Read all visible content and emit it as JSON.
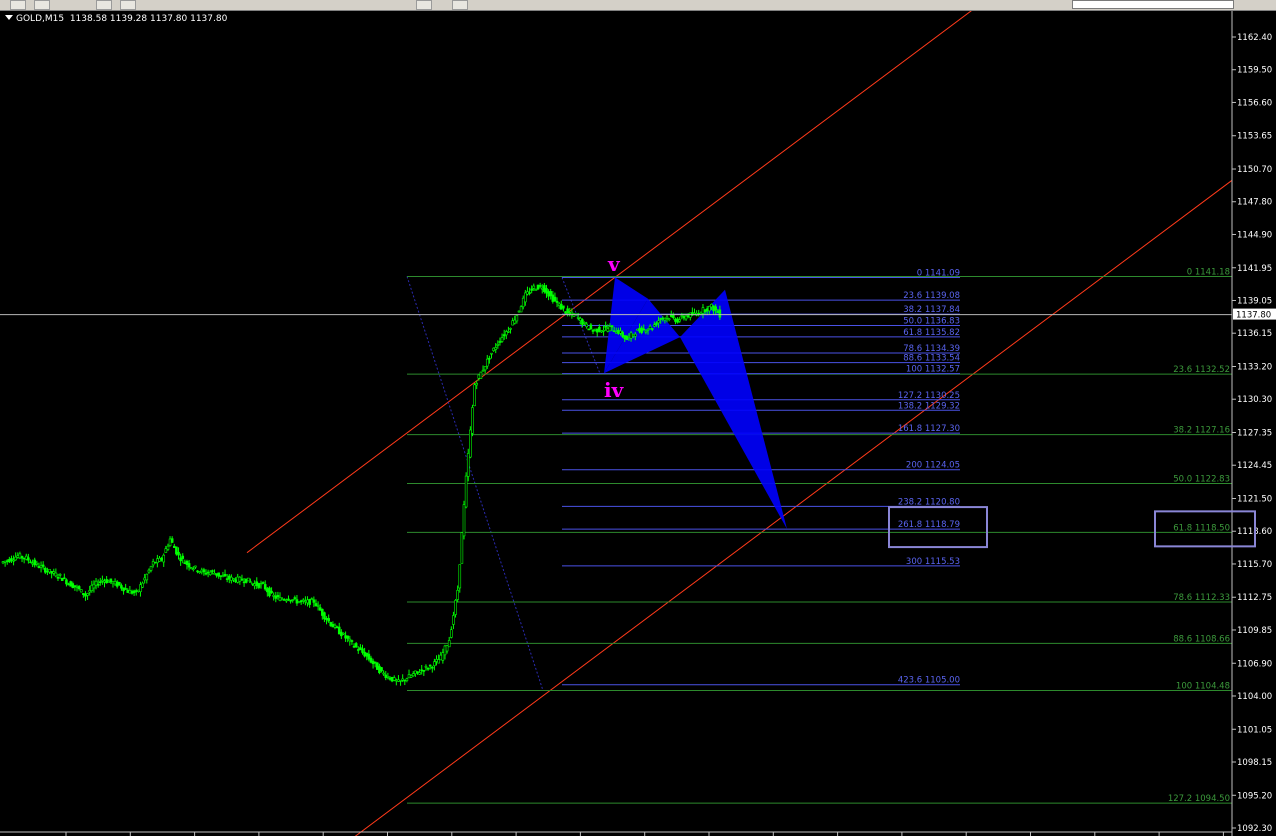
{
  "chart_header": {
    "symbol": "GOLD,M15",
    "open": "1138.58",
    "high": "1139.28",
    "low": "1137.80",
    "close": "1137.80"
  },
  "current_price": "1137.80",
  "wave_labels": {
    "v": "v",
    "iv": "iv"
  },
  "colors": {
    "background": "#000000",
    "candles": "#00ff00",
    "channel": "#ff3a1a",
    "fib_retracement": "#2d8a2d",
    "fib_extension": "#4a52e6",
    "pattern_fill": "#0000ff",
    "wave_label": "#ff00ff",
    "highlight_box": "#8a86d6"
  },
  "chart_data": {
    "type": "candlestick",
    "symbol": "GOLD",
    "timeframe": "M15",
    "ylim": [
      1092.3,
      1164.0
    ],
    "y_ticks": [
      "1162.40",
      "1159.50",
      "1156.60",
      "1153.65",
      "1150.70",
      "1147.80",
      "1144.90",
      "1141.95",
      "1139.05",
      "1136.15",
      "1133.20",
      "1130.30",
      "1127.35",
      "1124.45",
      "1121.50",
      "1118.60",
      "1115.70",
      "1112.75",
      "1109.85",
      "1106.90",
      "1104.00",
      "1101.05",
      "1098.15",
      "1095.20",
      "1092.30"
    ],
    "price_path": [
      1115.8,
      1116.1,
      1116.4,
      1116.2,
      1115.7,
      1115.3,
      1114.9,
      1114.6,
      1114.0,
      1113.6,
      1112.9,
      1113.8,
      1114.3,
      1114.1,
      1113.8,
      1113.3,
      1113.1,
      1114.4,
      1115.8,
      1116.1,
      1117.9,
      1116.4,
      1115.7,
      1115.3,
      1114.9,
      1115.0,
      1114.6,
      1114.4,
      1114.3,
      1114.3,
      1113.9,
      1113.8,
      1112.9,
      1112.6,
      1112.7,
      1112.4,
      1112.3,
      1112.4,
      1111.3,
      1110.4,
      1109.7,
      1109.0,
      1108.3,
      1107.7,
      1106.9,
      1106.1,
      1105.6,
      1105.2,
      1105.6,
      1106.0,
      1106.4,
      1106.7,
      1107.4,
      1109.0,
      1113.4,
      1123.3,
      1131.6,
      1133.0,
      1134.4,
      1135.6,
      1136.5,
      1137.8,
      1139.5,
      1140.2,
      1140.3,
      1139.4,
      1138.6,
      1137.9,
      1137.7,
      1136.9,
      1136.4,
      1136.5,
      1136.6,
      1136.3,
      1135.6,
      1136.3,
      1136.5,
      1136.7,
      1137.5,
      1137.6,
      1137.3,
      1137.7,
      1137.8,
      1138.2,
      1138.5,
      1137.8
    ],
    "fib_retracement": {
      "levels": [
        {
          "label": "0 1141.18",
          "value": 1141.18
        },
        {
          "label": "23.6 1132.52",
          "value": 1132.52
        },
        {
          "label": "38.2 1127.16",
          "value": 1127.16
        },
        {
          "label": "50.0 1122.83",
          "value": 1122.83
        },
        {
          "label": "61.8 1118.50",
          "value": 1118.5
        },
        {
          "label": "78.6 1112.33",
          "value": 1112.33
        },
        {
          "label": "88.6 1108.66",
          "value": 1108.66
        },
        {
          "label": "100 1104.48",
          "value": 1104.48
        },
        {
          "label": "127.2 1094.50",
          "value": 1094.5
        }
      ]
    },
    "fib_extension": {
      "levels": [
        {
          "label": "0 1141.09",
          "value": 1141.09
        },
        {
          "label": "23.6 1139.08",
          "value": 1139.08
        },
        {
          "label": "38.2 1137.84",
          "value": 1137.84
        },
        {
          "label": "50.0 1136.83",
          "value": 1136.83
        },
        {
          "label": "61.8 1135.82",
          "value": 1135.82
        },
        {
          "label": "78.6 1134.39",
          "value": 1134.39
        },
        {
          "label": "88.6 1133.54",
          "value": 1133.54
        },
        {
          "label": "100 1132.57",
          "value": 1132.57
        },
        {
          "label": "127.2 1130.25",
          "value": 1130.25
        },
        {
          "label": "138.2 1129.32",
          "value": 1129.32
        },
        {
          "label": "161.8 1127.30",
          "value": 1127.3
        },
        {
          "label": "200 1124.05",
          "value": 1124.05
        },
        {
          "label": "238.2 1120.80",
          "value": 1120.8
        },
        {
          "label": "261.8 1118.79",
          "value": 1118.79
        },
        {
          "label": "300 1115.53",
          "value": 1115.53
        },
        {
          "label": "423.6 1105.00",
          "value": 1105.0
        }
      ]
    },
    "channel": {
      "upper": [
        [
          1116.7,
          1118.6
        ],
        [
          1141.1,
          1141.1
        ]
      ],
      "lower": [
        [
          1104.48
        ],
        [
          1145.0
        ]
      ]
    },
    "pattern_points": [
      1141.1,
      1132.6,
      1139.2,
      1135.8,
      1140.0,
      1118.8
    ],
    "highlight_levels": [
      "261.8 1118.79",
      "61.8 1118.50"
    ]
  }
}
